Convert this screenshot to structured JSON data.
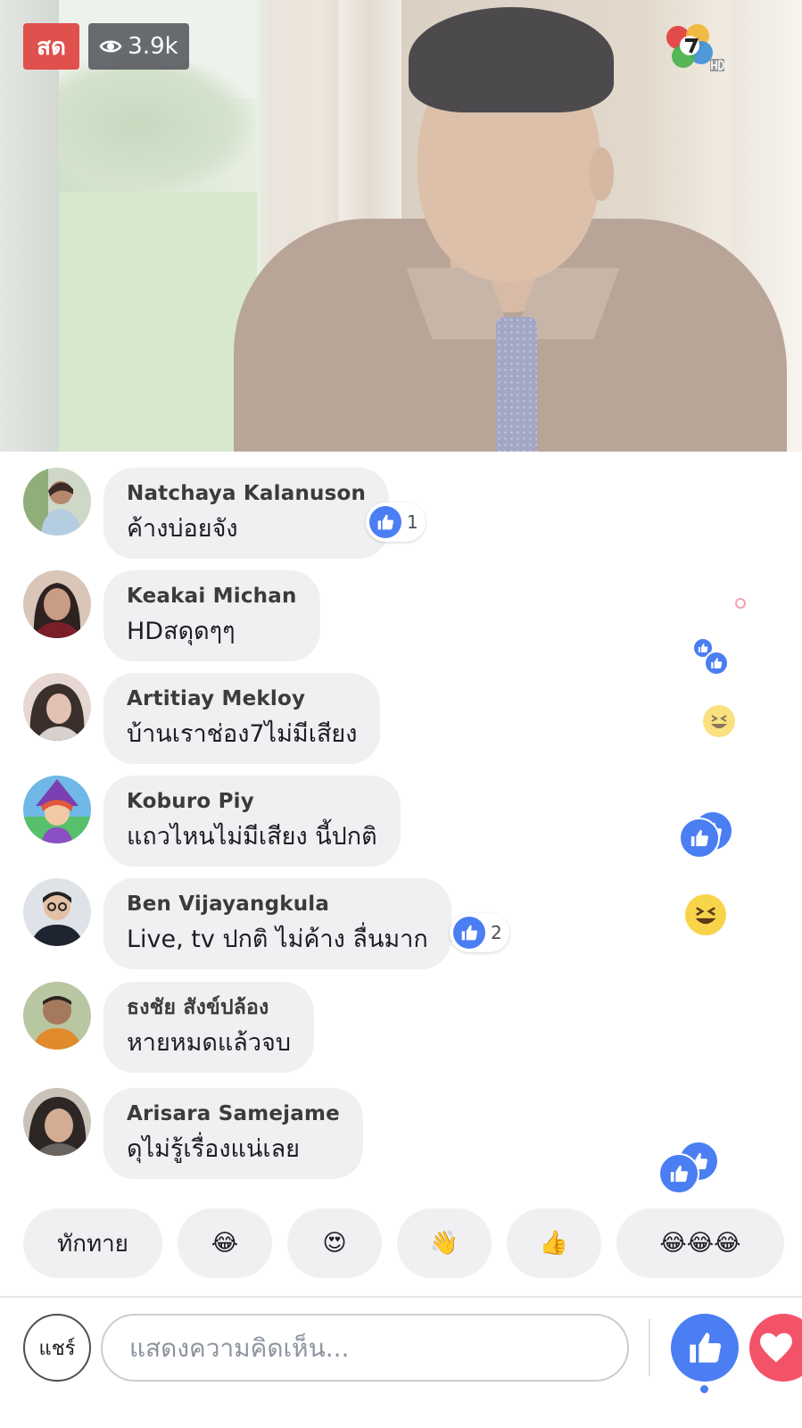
{
  "video": {
    "live_label": "สด",
    "view_count": "3.9k"
  },
  "comments": [
    {
      "name": "Natchaya Kalanuson",
      "text": "ค้างบ่อยจัง",
      "likes": "1"
    },
    {
      "name": "Keakai Michan",
      "text": "HDสดุดๆๆ"
    },
    {
      "name": "Artitiay Mekloy",
      "text": "บ้านเราช่อง7ไม่มีเสียง"
    },
    {
      "name": "Koburo Piy",
      "text": "แถวไหนไม่มีเสียง นี้ปกติ"
    },
    {
      "name": "Ben Vijayangkula",
      "text": "Live, tv ปกติ ไม่ค้าง ลื่นมาก",
      "likes": "2"
    },
    {
      "name": "ธงชัย สังข์ปล้อง",
      "text": "หายหมดแล้วจบ"
    },
    {
      "name": "Arisara Samejame",
      "text": "ดุไม่รู้เรื่องแน่เลย"
    }
  ],
  "quick_replies": {
    "greet": "ทักทาย",
    "laugh": "😂",
    "heart_eyes": "😍",
    "wave": "👋",
    "thumbs_up": "👍",
    "laugh_triple": "😂😂😂"
  },
  "composer": {
    "share_label": "แชร์",
    "placeholder": "แสดงความคิดเห็น..."
  },
  "colors": {
    "live_red": "#e0504d",
    "like_blue": "#4a7ef2",
    "love_red": "#f35369",
    "bubble_gray": "#f0f0f2"
  }
}
